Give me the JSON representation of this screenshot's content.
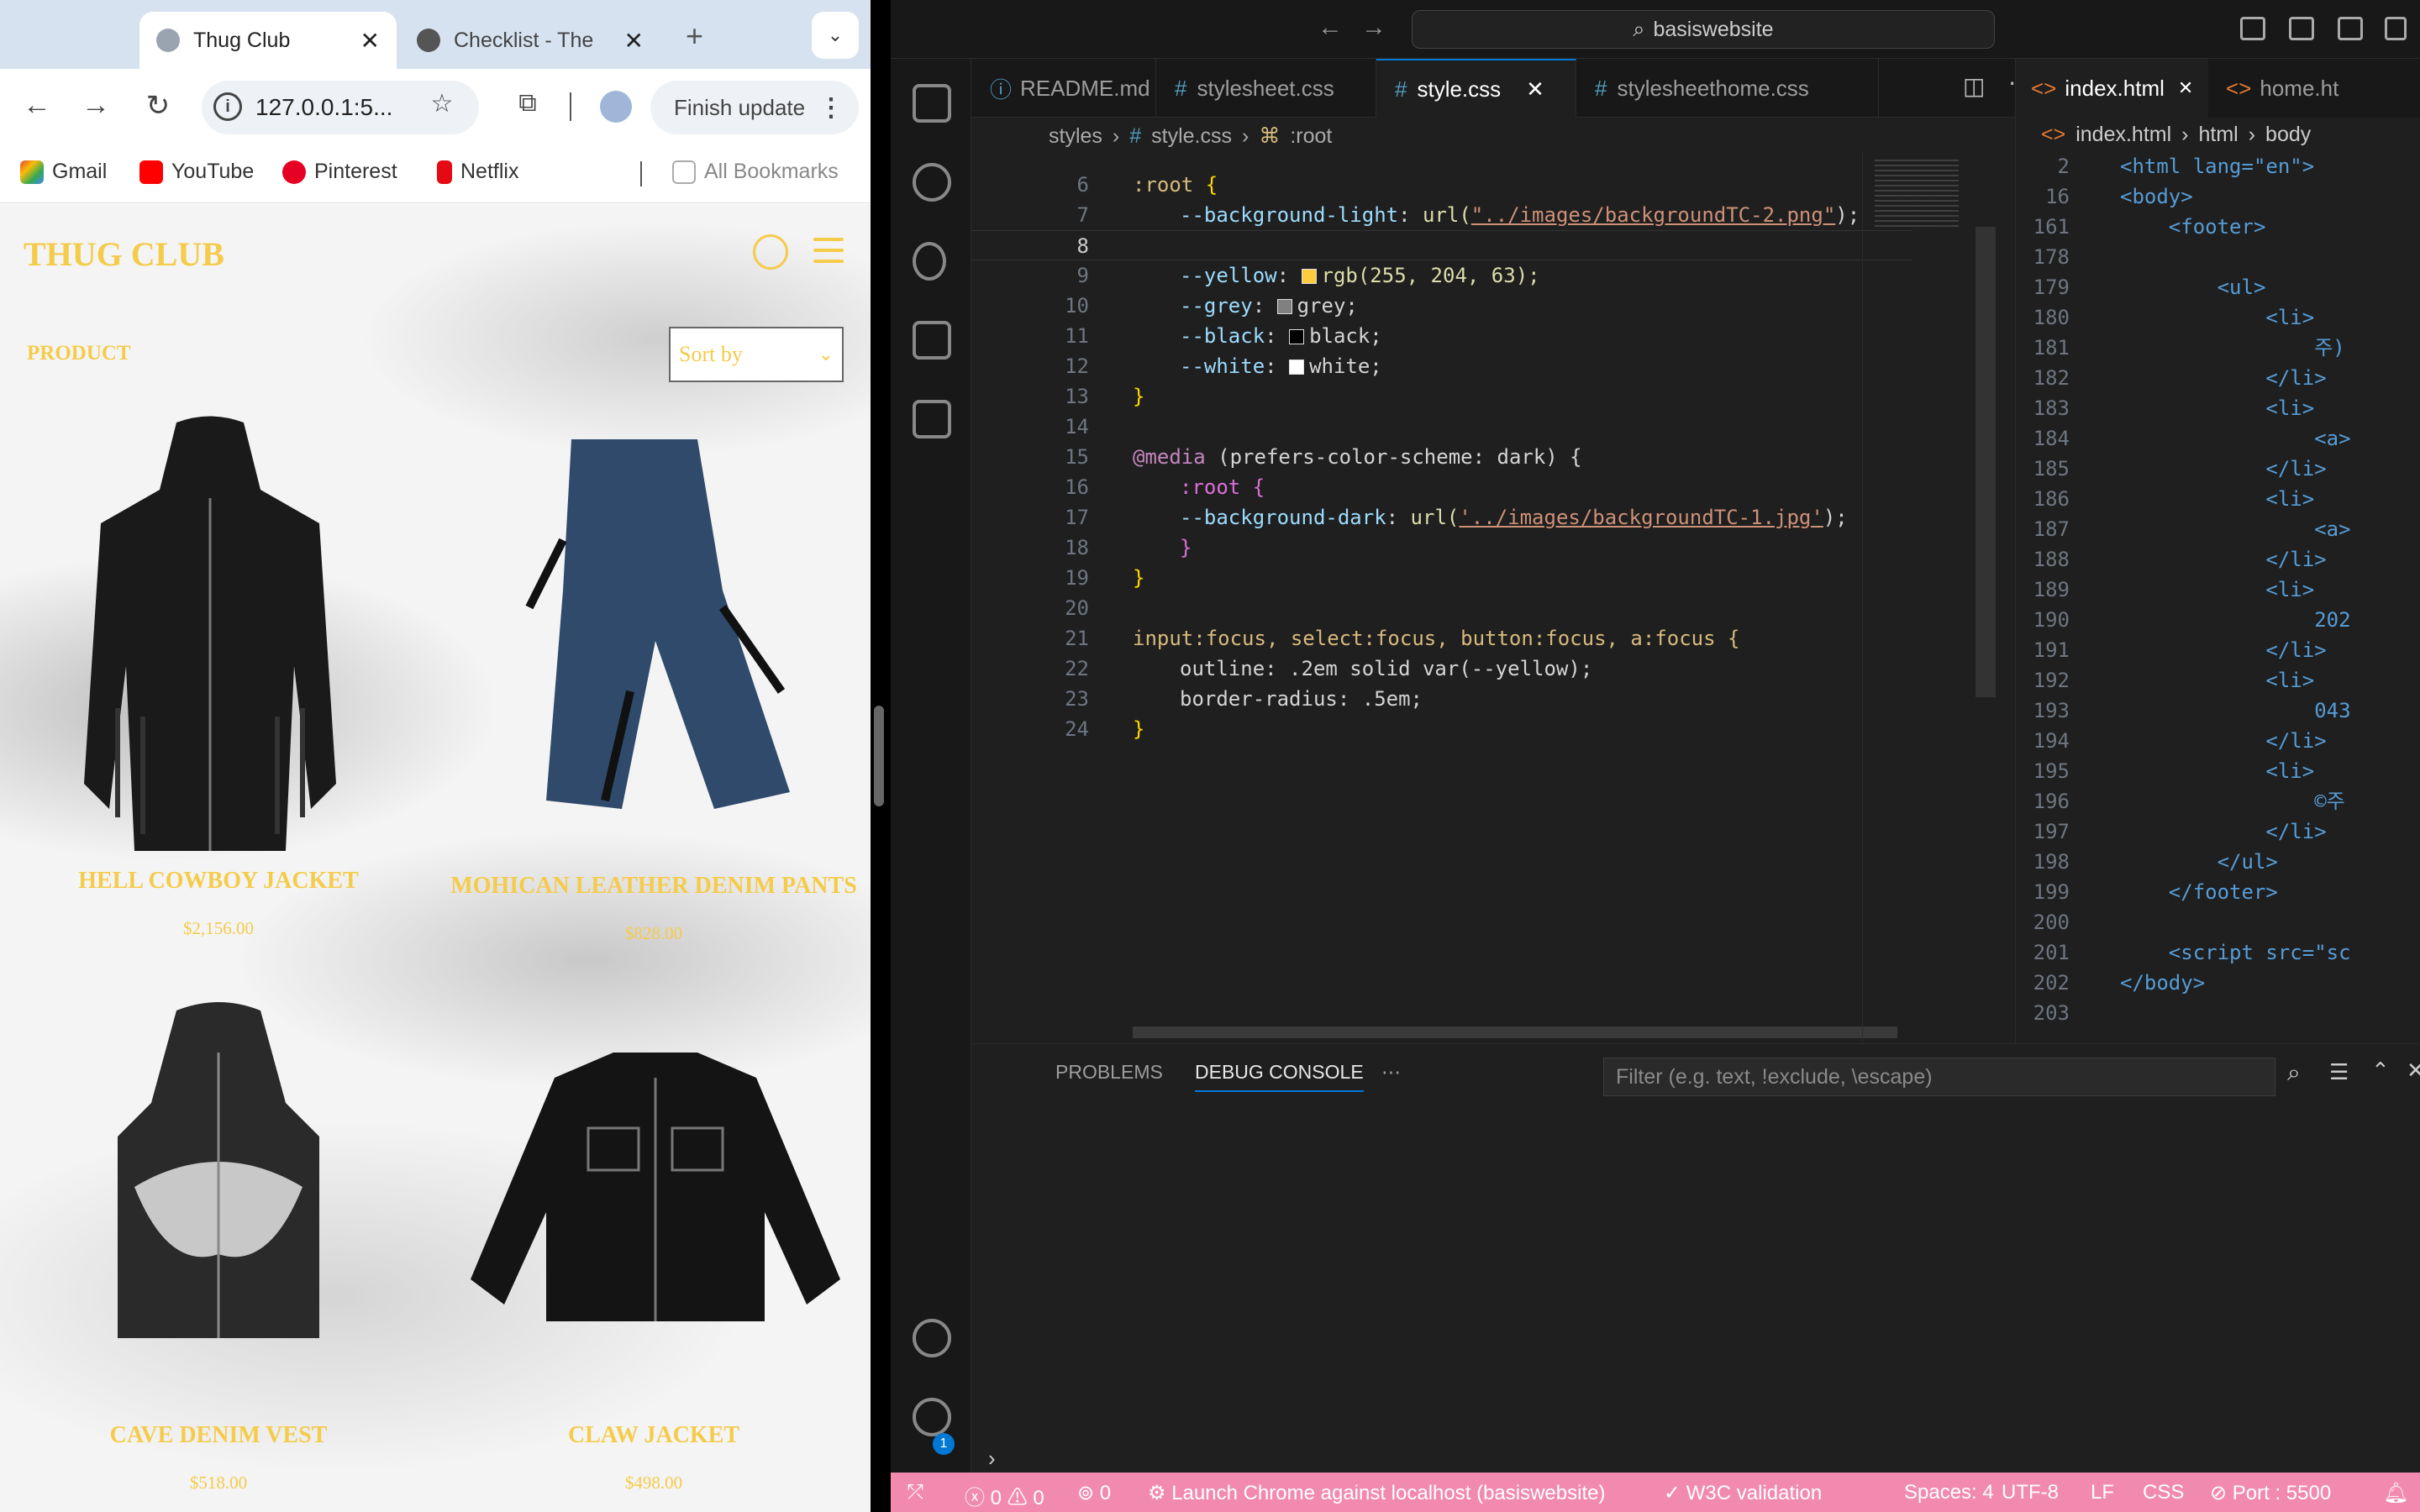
{
  "browser": {
    "tabs": [
      {
        "title": "Thug Club",
        "active": true
      },
      {
        "title": "Checklist - The",
        "active": false
      }
    ],
    "address": "127.0.0.1:5...",
    "update_label": "Finish update",
    "bookmarks": [
      "Gmail",
      "YouTube",
      "Pinterest",
      "Netflix",
      "All Bookmarks"
    ],
    "page": {
      "brand": "THUG CLUB",
      "section": "PRODUCT",
      "sort_label": "Sort by",
      "products": [
        {
          "name": "HELL COWBOY JACKET",
          "price": "$2,156.00"
        },
        {
          "name": "MOHICAN LEATHER DENIM PANTS",
          "price": "$828.00"
        },
        {
          "name": "CAVE DENIM VEST",
          "price": "$518.00"
        },
        {
          "name": "CLAW JACKET",
          "price": "$498.00"
        }
      ]
    }
  },
  "vscode": {
    "command_center": "basiswebsite",
    "tabs": [
      {
        "label": "README.md",
        "active": false
      },
      {
        "label": "stylesheet.css",
        "active": false
      },
      {
        "label": "style.css",
        "active": true
      },
      {
        "label": "stylesheethome.css",
        "active": false
      }
    ],
    "breadcrumbs": [
      "styles",
      "style.css",
      ":root"
    ],
    "right_tabs": [
      {
        "label": "index.html",
        "active": true
      },
      {
        "label": "home.ht",
        "active": false
      }
    ],
    "right_breadcrumbs": [
      "index.html",
      "html",
      "body"
    ],
    "lines": {
      "n6": "6",
      "t6": ":root",
      "n7": "7",
      "t7a": "--background-light",
      "t7b": "url(",
      "t7c": "\"../images/backgroundTC-2.png\"",
      "t7d": ");",
      "n8": "8",
      "n9": "9",
      "t9a": "--yellow",
      "t9b": "rgb(255, 204, 63);",
      "n10": "10",
      "t10a": "--grey",
      "t10b": "grey;",
      "n11": "11",
      "t11a": "--black",
      "t11b": "black;",
      "n12": "12",
      "t12a": "--white",
      "t12b": "white;",
      "n13": "13",
      "n14": "14",
      "n15": "15",
      "t15a": "@media",
      "t15b": "(prefers-color-scheme: dark) {",
      "n16": "16",
      "t16": ":root {",
      "n17": "17",
      "t17a": "--background-dark",
      "t17b": "url(",
      "t17c": "'../images/backgroundTC-1.jpg'",
      "t17d": ");",
      "n18": "18",
      "n19": "19",
      "n20": "20",
      "n21": "21",
      "t21": "input:focus, select:focus, button:focus, a:focus {",
      "n22": "22",
      "t22": "outline: .2em solid var(--yellow);",
      "n23": "23",
      "t23": "border-radius: .5em;",
      "n24": "24"
    },
    "right_lines": [
      {
        "n": "2",
        "t": "<html lang=\"en\">"
      },
      {
        "n": "16",
        "t": "<body>"
      },
      {
        "n": "161",
        "t": "    <footer>"
      },
      {
        "n": "178",
        "t": ""
      },
      {
        "n": "179",
        "t": "        <ul>"
      },
      {
        "n": "180",
        "t": "            <li>"
      },
      {
        "n": "181",
        "t": "                주)"
      },
      {
        "n": "182",
        "t": "            </li>"
      },
      {
        "n": "183",
        "t": "            <li>"
      },
      {
        "n": "184",
        "t": "                <a>"
      },
      {
        "n": "185",
        "t": "            </li>"
      },
      {
        "n": "186",
        "t": "            <li>"
      },
      {
        "n": "187",
        "t": "                <a>"
      },
      {
        "n": "188",
        "t": "            </li>"
      },
      {
        "n": "189",
        "t": "            <li>"
      },
      {
        "n": "190",
        "t": "                202"
      },
      {
        "n": "191",
        "t": "            </li>"
      },
      {
        "n": "192",
        "t": "            <li>"
      },
      {
        "n": "193",
        "t": "                043"
      },
      {
        "n": "194",
        "t": "            </li>"
      },
      {
        "n": "195",
        "t": "            <li>"
      },
      {
        "n": "196",
        "t": "                ©주"
      },
      {
        "n": "197",
        "t": "            </li>"
      },
      {
        "n": "198",
        "t": "        </ul>"
      },
      {
        "n": "199",
        "t": "    </footer>"
      },
      {
        "n": "200",
        "t": ""
      },
      {
        "n": "201",
        "t": "    <script src=\"sc"
      },
      {
        "n": "202",
        "t": "</body>"
      },
      {
        "n": "203",
        "t": ""
      }
    ],
    "panel_tabs": [
      "PROBLEMS",
      "DEBUG CONSOLE"
    ],
    "filter_placeholder": "Filter (e.g. text, !exclude, \\escape)",
    "status": {
      "errors": "0",
      "warnings": "0",
      "ports": "0",
      "launch": "Launch Chrome against localhost (basiswebsite)",
      "w3c": "W3C validation",
      "spaces": "Spaces: 4",
      "encoding": "UTF-8",
      "eol": "LF",
      "lang": "CSS",
      "port": "Port : 5500"
    },
    "settings_badge": "1"
  },
  "colors": {
    "brand_yellow": "#f5cb4a",
    "status_pink": "#f28ab0",
    "accent_blue": "#0078d4"
  }
}
